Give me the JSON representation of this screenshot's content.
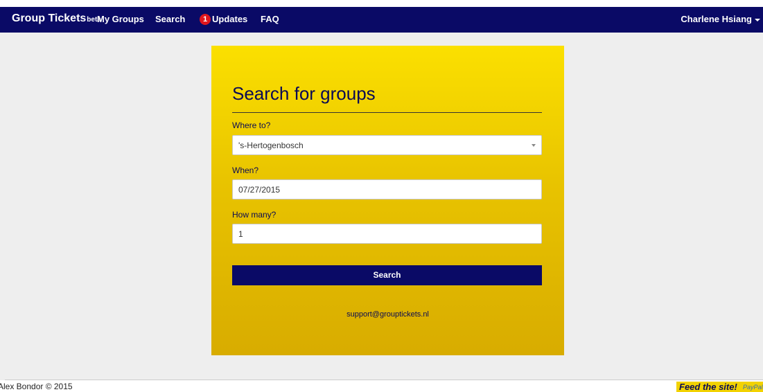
{
  "navbar": {
    "brand": "Group Tickets",
    "brand_tag": "beta",
    "links": {
      "my_groups": "My Groups",
      "search": "Search",
      "updates": "Updates",
      "faq": "FAQ"
    },
    "updates_count": "1",
    "user_name": "Charlene Hsiang"
  },
  "search_form": {
    "title": "Search for groups",
    "where_label": "Where to?",
    "where_value": "'s-Hertogenbosch",
    "when_label": "When?",
    "when_value": "07/27/2015",
    "how_many_label": "How many?",
    "how_many_value": "1",
    "submit_label": "Search",
    "support_email": "support@grouptickets.nl"
  },
  "footer": {
    "copyright": "Alex Bondor © 2015",
    "feed_label": "Feed the site!",
    "paypal_label": "PayPal"
  },
  "colors": {
    "navbar": "#0a0a66",
    "card_top": "#fbe000",
    "card_bottom": "#d8ac00",
    "badge": "#e0161d",
    "button": "#0a0a66"
  },
  "icons": {
    "user_menu": "chevron-down-icon",
    "select": "select-arrow-icon"
  }
}
